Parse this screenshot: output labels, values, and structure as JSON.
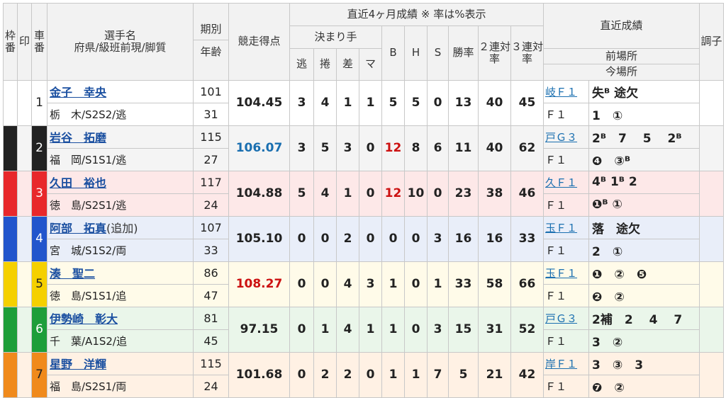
{
  "headers": {
    "waku": "枠番",
    "mark": "印",
    "car": "車番",
    "name": "選手名",
    "name_sub": "府県/級班前現/脚質",
    "period": "期別",
    "age": "年齢",
    "score": "競走得点",
    "recent_title": "直近4ヶ月成績 ※ 率は%表示",
    "kimarite": "決まり手",
    "nige": "逃",
    "makuri": "捲",
    "sashi": "差",
    "mark_k": "マ",
    "b": "B",
    "h": "H",
    "s": "S",
    "win_rate": "勝率",
    "rate2": "２連対率",
    "rate3": "３連対率",
    "recent_results": "直近成績",
    "prev_venue": "前場所",
    "curr_venue": "今場所",
    "condition": "調子"
  },
  "colors": {
    "lane1": "#ffffff",
    "lane2": "#222222",
    "lane3": "#e8282b",
    "lane4": "#2255cc",
    "lane5": "#f5d000",
    "lane6": "#1e9e3a",
    "lane7": "#f08a1c",
    "row1_bg": "#ffffff",
    "row2_bg": "#f4f4f4",
    "row3_bg": "#fde8e8",
    "row4_bg": "#e9eef9",
    "row5_bg": "#fffbe9",
    "row6_bg": "#eaf6ea",
    "row7_bg": "#fff1e4"
  },
  "riders": [
    {
      "car": "1",
      "name": "金子　幸央",
      "extra": "",
      "info": "栃　木/S2S2/逃",
      "period": "101",
      "age": "31",
      "score": "104.45",
      "score_color": "",
      "nige": "3",
      "makuri": "4",
      "sashi": "1",
      "mark": "1",
      "b": "5",
      "b_color": "",
      "h": "5",
      "s": "0",
      "win": "13",
      "r2": "40",
      "r3": "45",
      "prev_venue": "岐Ｆ１",
      "prev_results": "失ᴮ 途欠",
      "curr_venue": "Ｆ１",
      "curr_results": "1　①"
    },
    {
      "car": "2",
      "name": "岩谷　拓磨",
      "extra": "",
      "info": "福　岡/S1S1/逃",
      "period": "115",
      "age": "27",
      "score": "106.07",
      "score_color": "blue",
      "nige": "3",
      "makuri": "5",
      "sashi": "3",
      "mark": "0",
      "b": "12",
      "b_color": "red",
      "h": "8",
      "s": "6",
      "win": "11",
      "r2": "40",
      "r3": "62",
      "prev_venue": "戸Ｇ３",
      "prev_results": "2ᴮ　7　 5　 2ᴮ",
      "curr_venue": "Ｆ１",
      "curr_results": "❹　③ᴮ"
    },
    {
      "car": "3",
      "name": "久田　裕也",
      "extra": "",
      "info": "徳　島/S2S1/逃",
      "period": "117",
      "age": "24",
      "score": "104.88",
      "score_color": "",
      "nige": "5",
      "makuri": "4",
      "sashi": "1",
      "mark": "0",
      "b": "12",
      "b_color": "red",
      "h": "10",
      "s": "0",
      "win": "23",
      "r2": "38",
      "r3": "46",
      "prev_venue": "久Ｆ１",
      "prev_results": "4ᴮ 1ᴮ 2",
      "curr_venue": "Ｆ１",
      "curr_results": "❶ᴮ ①"
    },
    {
      "car": "4",
      "name": "阿部　拓真",
      "extra": "(追加)",
      "info": "宮　城/S1S2/両",
      "period": "107",
      "age": "33",
      "score": "105.10",
      "score_color": "",
      "nige": "0",
      "makuri": "0",
      "sashi": "2",
      "mark": "0",
      "b": "0",
      "b_color": "",
      "h": "0",
      "s": "3",
      "win": "16",
      "r2": "16",
      "r3": "33",
      "prev_venue": "玉Ｆ１",
      "prev_results": "落　途欠",
      "curr_venue": "Ｆ１",
      "curr_results": "2　①"
    },
    {
      "car": "5",
      "name": "湊　聖二",
      "extra": "",
      "info": "徳　島/S1S1/追",
      "period": "86",
      "age": "47",
      "score": "108.27",
      "score_color": "red",
      "nige": "0",
      "makuri": "0",
      "sashi": "4",
      "mark": "3",
      "b": "1",
      "b_color": "",
      "h": "0",
      "s": "1",
      "win": "33",
      "r2": "58",
      "r3": "66",
      "prev_venue": "玉Ｆ１",
      "prev_results": "❶　②　❺",
      "curr_venue": "Ｆ１",
      "curr_results": "❷　②"
    },
    {
      "car": "6",
      "name": "伊勢崎　彰大",
      "extra": "",
      "info": "千　葉/A1S2/追",
      "period": "81",
      "age": "45",
      "score": "97.15",
      "score_color": "",
      "nige": "0",
      "makuri": "1",
      "sashi": "4",
      "mark": "1",
      "b": "1",
      "b_color": "",
      "h": "0",
      "s": "3",
      "win": "15",
      "r2": "31",
      "r3": "52",
      "prev_venue": "戸Ｇ３",
      "prev_results": "2補　2　 4　 7",
      "curr_venue": "Ｆ１",
      "curr_results": "3　②"
    },
    {
      "car": "7",
      "name": "星野　洋輝",
      "extra": "",
      "info": "福　島/S2S1/両",
      "period": "115",
      "age": "24",
      "score": "101.68",
      "score_color": "",
      "nige": "0",
      "makuri": "2",
      "sashi": "2",
      "mark": "0",
      "b": "1",
      "b_color": "",
      "h": "1",
      "s": "7",
      "win": "5",
      "r2": "21",
      "r3": "42",
      "prev_venue": "岸Ｆ１",
      "prev_results": "3　③　3",
      "curr_venue": "Ｆ１",
      "curr_results": "❼　②"
    }
  ]
}
